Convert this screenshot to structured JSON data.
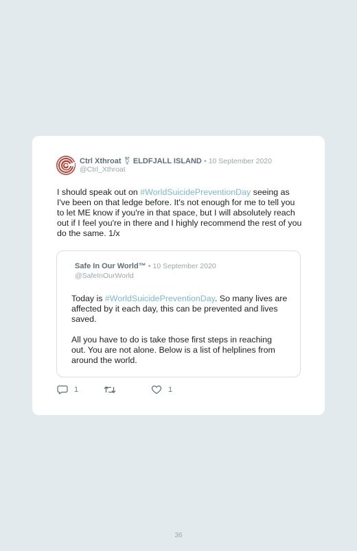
{
  "tweet": {
    "author_name": "Ctrl Xthroat",
    "gender_symbol": "⚧",
    "location": "ELDFJALL ISLAND",
    "date": "10 September 2020",
    "handle": "@Ctrl_Xthroat",
    "text_before": "I should speak out on ",
    "hashtag": "#WorldSuicidePreventionDay",
    "text_after": " seeing as I've been on that ledge before. It's not enough for me to tell you to let ME know if you're in that space, but I will absolutely reach out if I feel you're in there and I highly recommend the rest of you do the same. 1/x"
  },
  "quoted": {
    "author_name": "Safe In Our World™",
    "date": "10 September 2020",
    "handle": "@SafeInOurWorld",
    "p1_before": "Today is ",
    "hashtag": "#WorldSuicidePreventionDay",
    "p1_after": ". So many lives are affected by it each day, this can be prevented and lives saved.",
    "p2": "All you have to do is take those first steps in reaching out. You are not alone. Below is a list of helplines from around the world."
  },
  "actions": {
    "reply_count": "1",
    "retweet_count": "",
    "like_count": "1"
  },
  "colors": {
    "background": "#e2eaed",
    "card": "#ffffff",
    "hashtag": "#78b8d8",
    "avatar_red": "#c0392b"
  },
  "icons": [
    "avatar-spiral",
    "reply-icon",
    "retweet-icon",
    "like-icon"
  ],
  "page_number": "36"
}
